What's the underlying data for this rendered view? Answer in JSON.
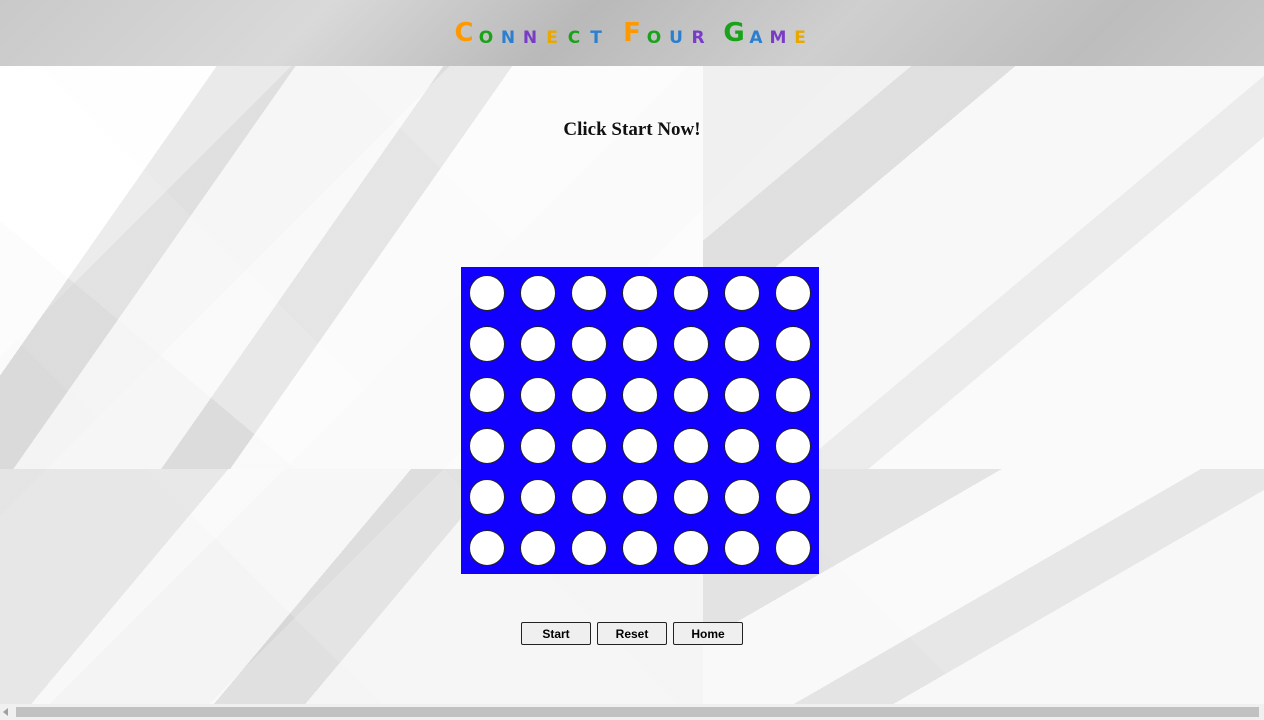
{
  "header": {
    "title_letters": [
      {
        "ch": "C",
        "color": "#ff9900",
        "big": true
      },
      {
        "ch": "O",
        "color": "#1aa31a",
        "big": false
      },
      {
        "ch": "N",
        "color": "#2a7fd0",
        "big": false
      },
      {
        "ch": "N",
        "color": "#7a3cc6",
        "big": false
      },
      {
        "ch": "E",
        "color": "#e8a800",
        "big": false
      },
      {
        "ch": "C",
        "color": "#1aa31a",
        "big": false
      },
      {
        "ch": "T",
        "color": "#2a7fd0",
        "big": false
      },
      {
        "ch": " ",
        "color": "#000000",
        "big": false
      },
      {
        "ch": "F",
        "color": "#ff9900",
        "big": true
      },
      {
        "ch": "O",
        "color": "#1aa31a",
        "big": false
      },
      {
        "ch": "U",
        "color": "#2a7fd0",
        "big": false
      },
      {
        "ch": "R",
        "color": "#7a3cc6",
        "big": false
      },
      {
        "ch": " ",
        "color": "#000000",
        "big": false
      },
      {
        "ch": "G",
        "color": "#1aa31a",
        "big": true
      },
      {
        "ch": "A",
        "color": "#2a7fd0",
        "big": false
      },
      {
        "ch": "M",
        "color": "#7a3cc6",
        "big": false
      },
      {
        "ch": "E",
        "color": "#e8a800",
        "big": false
      }
    ]
  },
  "status": {
    "message": "Click Start Now!"
  },
  "board": {
    "rows": 6,
    "columns": 7,
    "board_color": "#1100ff",
    "empty_cell_color": "#ffffff"
  },
  "controls": {
    "start_label": "Start",
    "reset_label": "Reset",
    "home_label": "Home"
  }
}
